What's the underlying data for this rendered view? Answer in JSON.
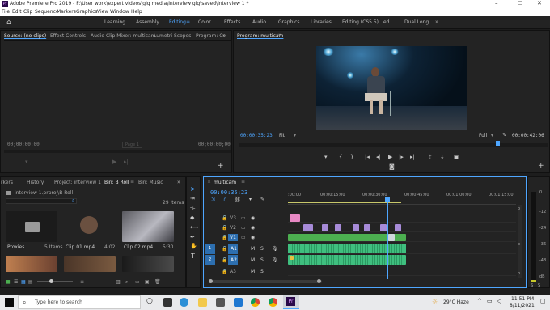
{
  "window": {
    "title": "Adobe Premiere Pro 2019 - F:\\User work\\expert videos\\gig media\\interview gig\\saved\\interview 1 *",
    "minimize": "–",
    "maximize": "☐",
    "close": "✕"
  },
  "menu": [
    "File",
    "Edit",
    "Clip",
    "Sequence",
    "Markers",
    "Graphics",
    "View",
    "Window",
    "Help"
  ],
  "workspaces": [
    "Learning",
    "Assembly",
    "Editing",
    "Color",
    "Effects",
    "Audio",
    "Graphics",
    "Libraries",
    "Editing (CS5.5)",
    "ed",
    "Dual Long"
  ],
  "workspace_menu_icon": "≡",
  "source_panel": {
    "tabs": [
      "Source: (no clips)",
      "Effect Controls",
      "Audio Clip Mixer: multicam",
      "Lumetri Scopes",
      "Program: Cc"
    ],
    "timecode_left": "00;00;00;00",
    "page_label": "Page 1",
    "timecode_right": "00;00;00;00"
  },
  "program_panel": {
    "tab": "Program: multicam",
    "timecode": "00:00:35:23",
    "fit": "Fit",
    "quality": "Full",
    "duration": "00:00:42:06"
  },
  "project_panel": {
    "tabs": [
      "rkers",
      "History",
      "Project: interview 1",
      "Bin: B Roll",
      "Bin: Music"
    ],
    "path": "interview 1.prproj\\B Roll",
    "item_count": "29 Items",
    "items": [
      {
        "name": "Proxies",
        "meta": "5 Items",
        "kind": "folder"
      },
      {
        "name": "Clip 01.mp4",
        "meta": "4:02",
        "kind": "video",
        "color": "#3a2a22"
      },
      {
        "name": "Clip 02.mp4",
        "meta": "5:30",
        "kind": "video",
        "color": "#6b6b70"
      },
      {
        "name": "",
        "meta": "",
        "kind": "video",
        "color": "#8a5a3a"
      },
      {
        "name": "",
        "meta": "",
        "kind": "video",
        "color": "#4a3528"
      },
      {
        "name": "",
        "meta": "",
        "kind": "video",
        "color": "#2a2a2a"
      }
    ]
  },
  "timeline": {
    "tab": "multicam",
    "timecode": "00:00:35:23",
    "ruler": [
      ":00:00",
      "00:00:15:00",
      "00:00:30:00",
      "00:00:45:00",
      "00:01:00:00",
      "00:01:15:00"
    ],
    "tracks": [
      {
        "label": "V3",
        "kind": "video"
      },
      {
        "label": "V2",
        "kind": "video"
      },
      {
        "label": "V1",
        "kind": "video"
      },
      {
        "label": "A1",
        "kind": "audio"
      },
      {
        "label": "A2",
        "kind": "audio"
      },
      {
        "label": "A3",
        "kind": "audio"
      }
    ],
    "track_numbers": [
      "1",
      "2"
    ],
    "track_buttons": [
      "M",
      "S"
    ],
    "playhead_fraction": 0.41
  },
  "meter": {
    "labels": [
      "0",
      "-12",
      "-24",
      "-36",
      "-48",
      "dB"
    ],
    "solo": [
      "S",
      "S"
    ]
  },
  "taskbar": {
    "search_placeholder": "Type here to search",
    "weather": "29°C  Haze",
    "time": "11:51 PM",
    "date": "8/11/2021",
    "lang": "ENG"
  },
  "colors": {
    "accent": "#4ea6ff",
    "video_clip": "#a78bd8",
    "audio_clip": "#3fbf7f",
    "v1_clip": "#4caf50",
    "title_clip": "#e889c4"
  }
}
